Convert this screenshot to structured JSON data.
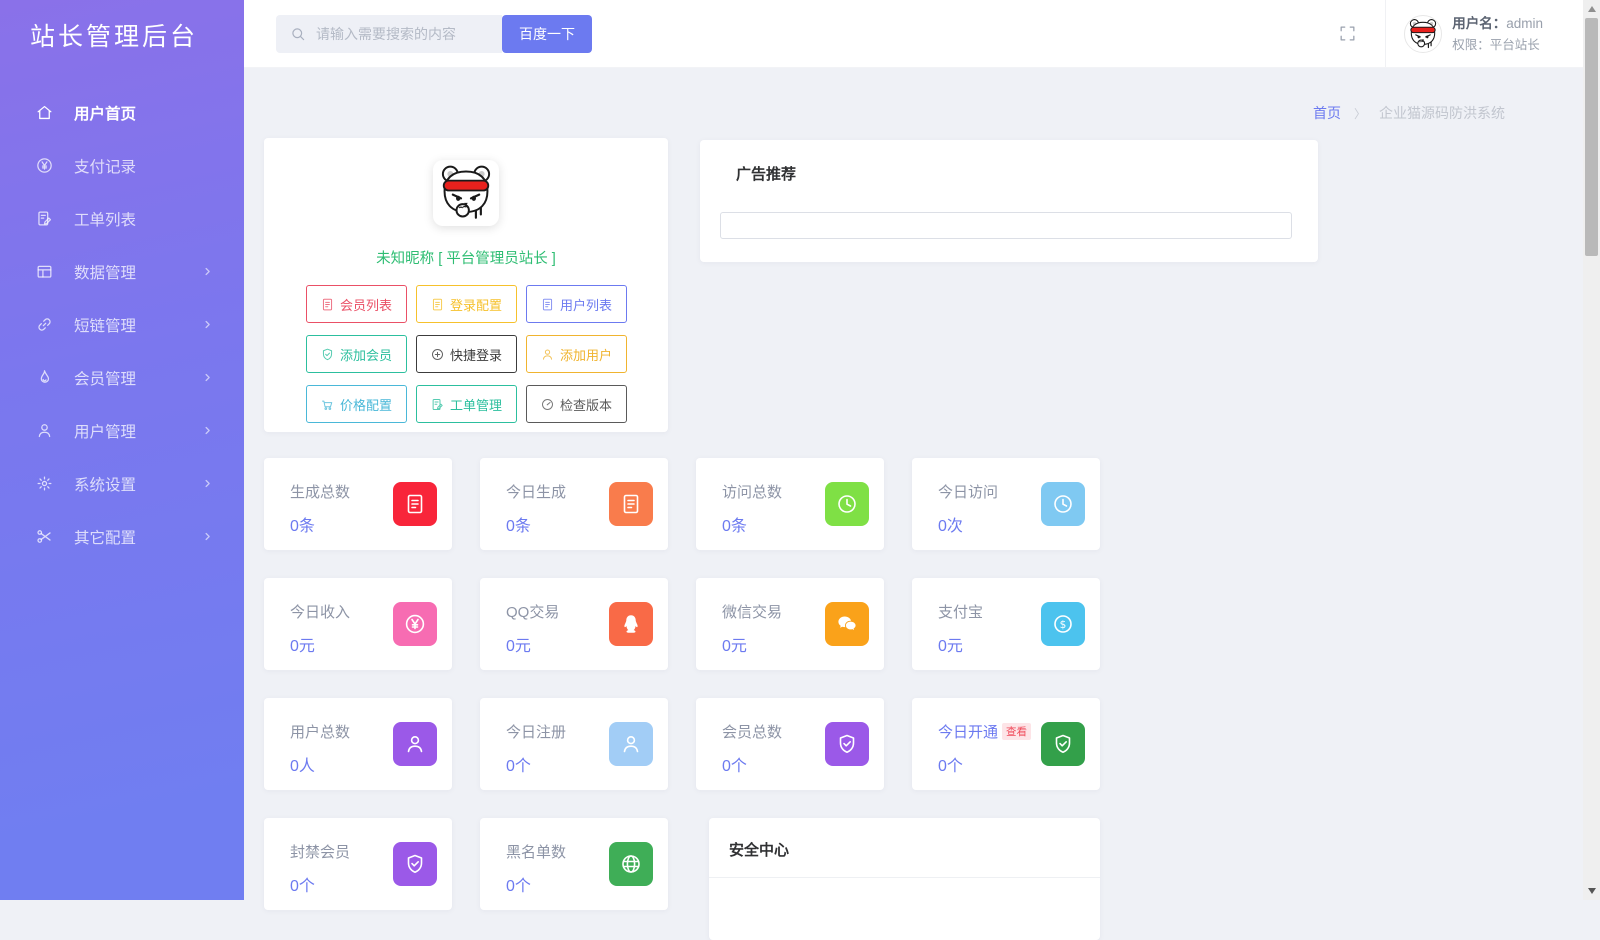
{
  "theme": {
    "accent": "#6c7af0",
    "sidebar_top": "#8a71e9",
    "sidebar_bottom": "#707ef1",
    "value_color": "#6c7af0",
    "nickname_color": "#2dbd72"
  },
  "app": {
    "logo": "站长管理后台"
  },
  "sidebar": [
    {
      "icon": "home",
      "label": "用户首页",
      "active": true,
      "arrow": false
    },
    {
      "icon": "yen-circle",
      "label": "支付记录",
      "active": false,
      "arrow": false
    },
    {
      "icon": "doc-pen",
      "label": "工单列表",
      "active": false,
      "arrow": false
    },
    {
      "icon": "table",
      "label": "数据管理",
      "active": false,
      "arrow": true
    },
    {
      "icon": "link",
      "label": "短链管理",
      "active": false,
      "arrow": true
    },
    {
      "icon": "flame",
      "label": "会员管理",
      "active": false,
      "arrow": true
    },
    {
      "icon": "user",
      "label": "用户管理",
      "active": false,
      "arrow": true
    },
    {
      "icon": "gear",
      "label": "系统设置",
      "active": false,
      "arrow": true
    },
    {
      "icon": "scissors",
      "label": "其它配置",
      "active": false,
      "arrow": true
    }
  ],
  "topbar": {
    "search_placeholder": "请输入需要搜索的内容",
    "search_button": "百度一下",
    "user_name_label": "用户名：",
    "user_name": "admin",
    "user_role_label": "权限：",
    "user_role": "平台站长"
  },
  "breadcrumb": {
    "home": "首页",
    "separator": "〉",
    "current": "企业猫源码防洪系统"
  },
  "profile": {
    "nickname": "未知昵称 [ 平台管理员站长 ]",
    "buttons": [
      {
        "icon": "file-text",
        "label": "会员列表",
        "color": "#ea5066"
      },
      {
        "icon": "file-text",
        "label": "登录配置",
        "color": "#f6c12c"
      },
      {
        "icon": "file-text",
        "label": "用户列表",
        "color": "#6c7af0"
      },
      {
        "icon": "shield-check",
        "label": "添加会员",
        "color": "#2cbf9e"
      },
      {
        "icon": "plus-circle",
        "label": "快捷登录",
        "color": "#3c3c3c"
      },
      {
        "icon": "user",
        "label": "添加用户",
        "color": "#f0b42f"
      },
      {
        "icon": "cart",
        "label": "价格配置",
        "color": "#4ab8d8"
      },
      {
        "icon": "doc-pen",
        "label": "工单管理",
        "color": "#2cbf9e"
      },
      {
        "icon": "gauge",
        "label": "检查版本",
        "color": "#5a5a5a"
      }
    ]
  },
  "ad_card": {
    "title": "广告推荐",
    "input_value": ""
  },
  "stats": [
    {
      "title": "生成总数",
      "value": "0条",
      "icon": "file-text",
      "color": "#f8253a"
    },
    {
      "title": "今日生成",
      "value": "0条",
      "icon": "file-text",
      "color": "#f97c4c"
    },
    {
      "title": "访问总数",
      "value": "0条",
      "icon": "clock",
      "color": "#7fe045"
    },
    {
      "title": "今日访问",
      "value": "0次",
      "icon": "clock",
      "color": "#7fc9f2"
    },
    {
      "title": "今日收入",
      "value": "0元",
      "icon": "yen-circle",
      "color": "#f76cb2"
    },
    {
      "title": "QQ交易",
      "value": "0元",
      "icon": "qq",
      "color": "#f96a47"
    },
    {
      "title": "微信交易",
      "value": "0元",
      "icon": "wechat",
      "color": "#faa21a"
    },
    {
      "title": "支付宝",
      "value": "0元",
      "icon": "dollar-circle",
      "color": "#4cc3ee"
    },
    {
      "title": "用户总数",
      "value": "0人",
      "icon": "user",
      "color": "#9b59e8"
    },
    {
      "title": "今日注册",
      "value": "0个",
      "icon": "user",
      "color": "#a2cdf6"
    },
    {
      "title": "会员总数",
      "value": "0个",
      "icon": "shield-check",
      "color": "#9b59e8"
    },
    {
      "title": "今日开通",
      "value": "0个",
      "icon": "shield-check",
      "color": "#33a04a",
      "title_color": "#6c7af0",
      "badge": "查看"
    },
    {
      "title": "封禁会员",
      "value": "0个",
      "icon": "shield-check",
      "color": "#9b59e8"
    },
    {
      "title": "黑名单数",
      "value": "0个",
      "icon": "globe",
      "color": "#3fae57"
    }
  ],
  "security_card": {
    "title": "安全中心"
  }
}
